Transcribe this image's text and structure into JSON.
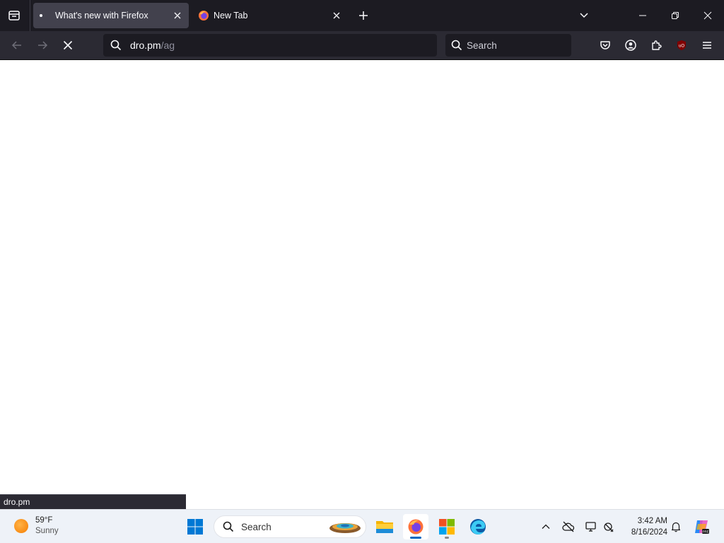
{
  "browser": {
    "tabs": [
      {
        "label": "What's new with Firefox",
        "active": true
      },
      {
        "label": "New Tab",
        "active": false
      }
    ],
    "urlbar": {
      "host": "dro.pm",
      "path": "/ag"
    },
    "search_placeholder": "Search",
    "status_text": "dro.pm"
  },
  "taskbar": {
    "weather": {
      "temp": "59°F",
      "condition": "Sunny"
    },
    "search_placeholder": "Search",
    "clock": {
      "time": "3:42 AM",
      "date": "8/16/2024"
    }
  },
  "colors": {
    "tabbar_bg": "#1c1b22",
    "navbar_bg": "#2b2a33",
    "active_tab_bg": "#42414d",
    "taskbar_bg": "#eef2f8",
    "accent": "#0067c0"
  },
  "icons": [
    "tab-list-icon",
    "close-icon",
    "plus-icon",
    "chevron-down-icon",
    "minimize-icon",
    "restore-icon",
    "window-close-icon",
    "back-arrow-icon",
    "forward-arrow-icon",
    "stop-loading-icon",
    "search-icon",
    "pocket-icon",
    "account-icon",
    "extensions-icon",
    "ublock-icon",
    "hamburger-menu-icon",
    "windows-start-icon",
    "file-explorer-icon",
    "firefox-icon",
    "microsoft-store-icon",
    "edge-icon",
    "chevron-up-icon",
    "cloud-offline-icon",
    "display-icon",
    "network-icon",
    "bell-icon",
    "copilot-icon"
  ]
}
